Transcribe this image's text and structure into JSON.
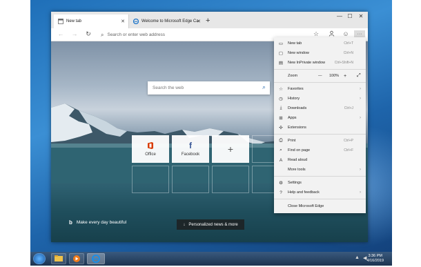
{
  "tabs": [
    {
      "label": "New tab",
      "active": true
    },
    {
      "label": "Welcome to Microsoft Edge Ca",
      "active": false
    }
  ],
  "address": {
    "placeholder": "Search or enter web address"
  },
  "search": {
    "placeholder": "Search the web"
  },
  "tiles": [
    {
      "label": "Office",
      "icon": "office-icon",
      "color": "#d83b01"
    },
    {
      "label": "Facebook",
      "icon": "facebook-icon",
      "color": "#3b5998"
    },
    {
      "label": "",
      "icon": "plus-icon",
      "color": "#555555"
    }
  ],
  "bing": {
    "text": "Make every day beautiful"
  },
  "news": {
    "label": "Personalized news & more"
  },
  "menu": {
    "new_tab": {
      "label": "New tab",
      "shortcut": "Ctrl+T"
    },
    "new_window": {
      "label": "New window",
      "shortcut": "Ctrl+N"
    },
    "inprivate": {
      "label": "New InPrivate window",
      "shortcut": "Ctrl+Shift+N"
    },
    "zoom": {
      "label": "Zoom",
      "minus": "—",
      "value": "100%",
      "plus": "+"
    },
    "favorites": {
      "label": "Favorites"
    },
    "history": {
      "label": "History"
    },
    "downloads": {
      "label": "Downloads",
      "shortcut": "Ctrl+J"
    },
    "apps": {
      "label": "Apps"
    },
    "extensions": {
      "label": "Extensions"
    },
    "print": {
      "label": "Print",
      "shortcut": "Ctrl+P"
    },
    "find": {
      "label": "Find on page",
      "shortcut": "Ctrl+F"
    },
    "read_aloud": {
      "label": "Read aloud"
    },
    "more_tools": {
      "label": "More tools"
    },
    "settings": {
      "label": "Settings"
    },
    "help": {
      "label": "Help and feedback"
    },
    "close": {
      "label": "Close Microsoft Edge"
    }
  },
  "clock": {
    "time": "3:36 PM",
    "date": "4/16/2019"
  },
  "colors": {
    "accent": "#2b6cb0",
    "menu_bg": "#f2f2f2"
  }
}
